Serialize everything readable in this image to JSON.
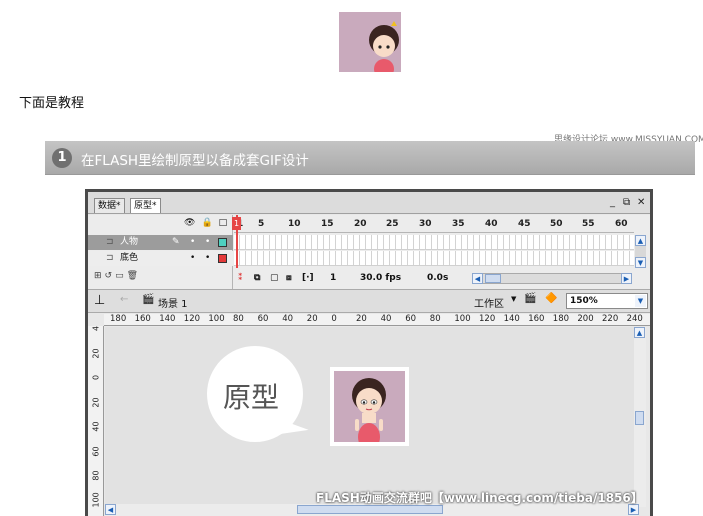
{
  "intro_text": "下面是教程",
  "watermark_top": "思缘设计论坛 www.MISSYUAN.COM",
  "step": {
    "number": "1",
    "title": "在FLASH里绘制原型以备成套GIF设计"
  },
  "flash": {
    "doc_tabs": [
      "数据*",
      "原型*"
    ],
    "win_controls": [
      "_",
      "⧉",
      "✕"
    ],
    "timeline": {
      "header_icons": [
        "eye-icon",
        "lock-icon",
        "outline-icon"
      ],
      "layers": [
        {
          "name": "人物",
          "swatch_color": "#4fd0c0"
        },
        {
          "name": "底色",
          "swatch_color": "#e43a3a"
        }
      ],
      "frame_numbers": [
        "1",
        "5",
        "10",
        "15",
        "20",
        "25",
        "30",
        "35",
        "40",
        "45",
        "50",
        "55",
        "60"
      ],
      "current_frame": "1",
      "fps": "30.0 fps",
      "time": "0.0s"
    },
    "editbar": {
      "scene": "场景 1",
      "workspace": "工作区",
      "zoom": "150%"
    },
    "ruler_h": [
      "180",
      "160",
      "140",
      "120",
      "100",
      "80",
      "60",
      "40",
      "20",
      "0",
      "20",
      "40",
      "60",
      "80",
      "100",
      "120",
      "140",
      "160",
      "180",
      "200",
      "220",
      "240"
    ],
    "ruler_v": [
      "4",
      "20",
      "0",
      "20",
      "40",
      "60",
      "80",
      "100"
    ],
    "stage": {
      "bubble_text": "原型"
    }
  },
  "watermark_bottom": "FLASH动画交流群吧【www.linecg.com/tieba/1856】",
  "colors": {
    "accent_red": "#e64545",
    "banner": "#b0b0b0",
    "character_bg": "#c9aabd"
  }
}
